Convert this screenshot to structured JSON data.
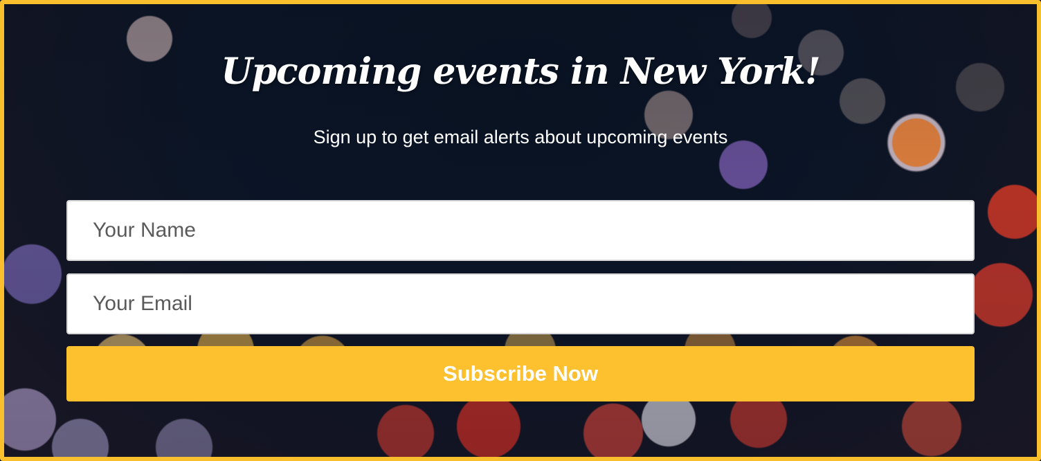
{
  "header": {
    "title": "Upcoming events in New York!",
    "subtitle": "Sign up to get email alerts about upcoming events"
  },
  "form": {
    "name_placeholder": "Your Name",
    "email_placeholder": "Your Email",
    "submit_label": "Subscribe Now"
  },
  "colors": {
    "accent": "#fdc02f",
    "border": "#f9bf2d",
    "text": "#ffffff"
  }
}
